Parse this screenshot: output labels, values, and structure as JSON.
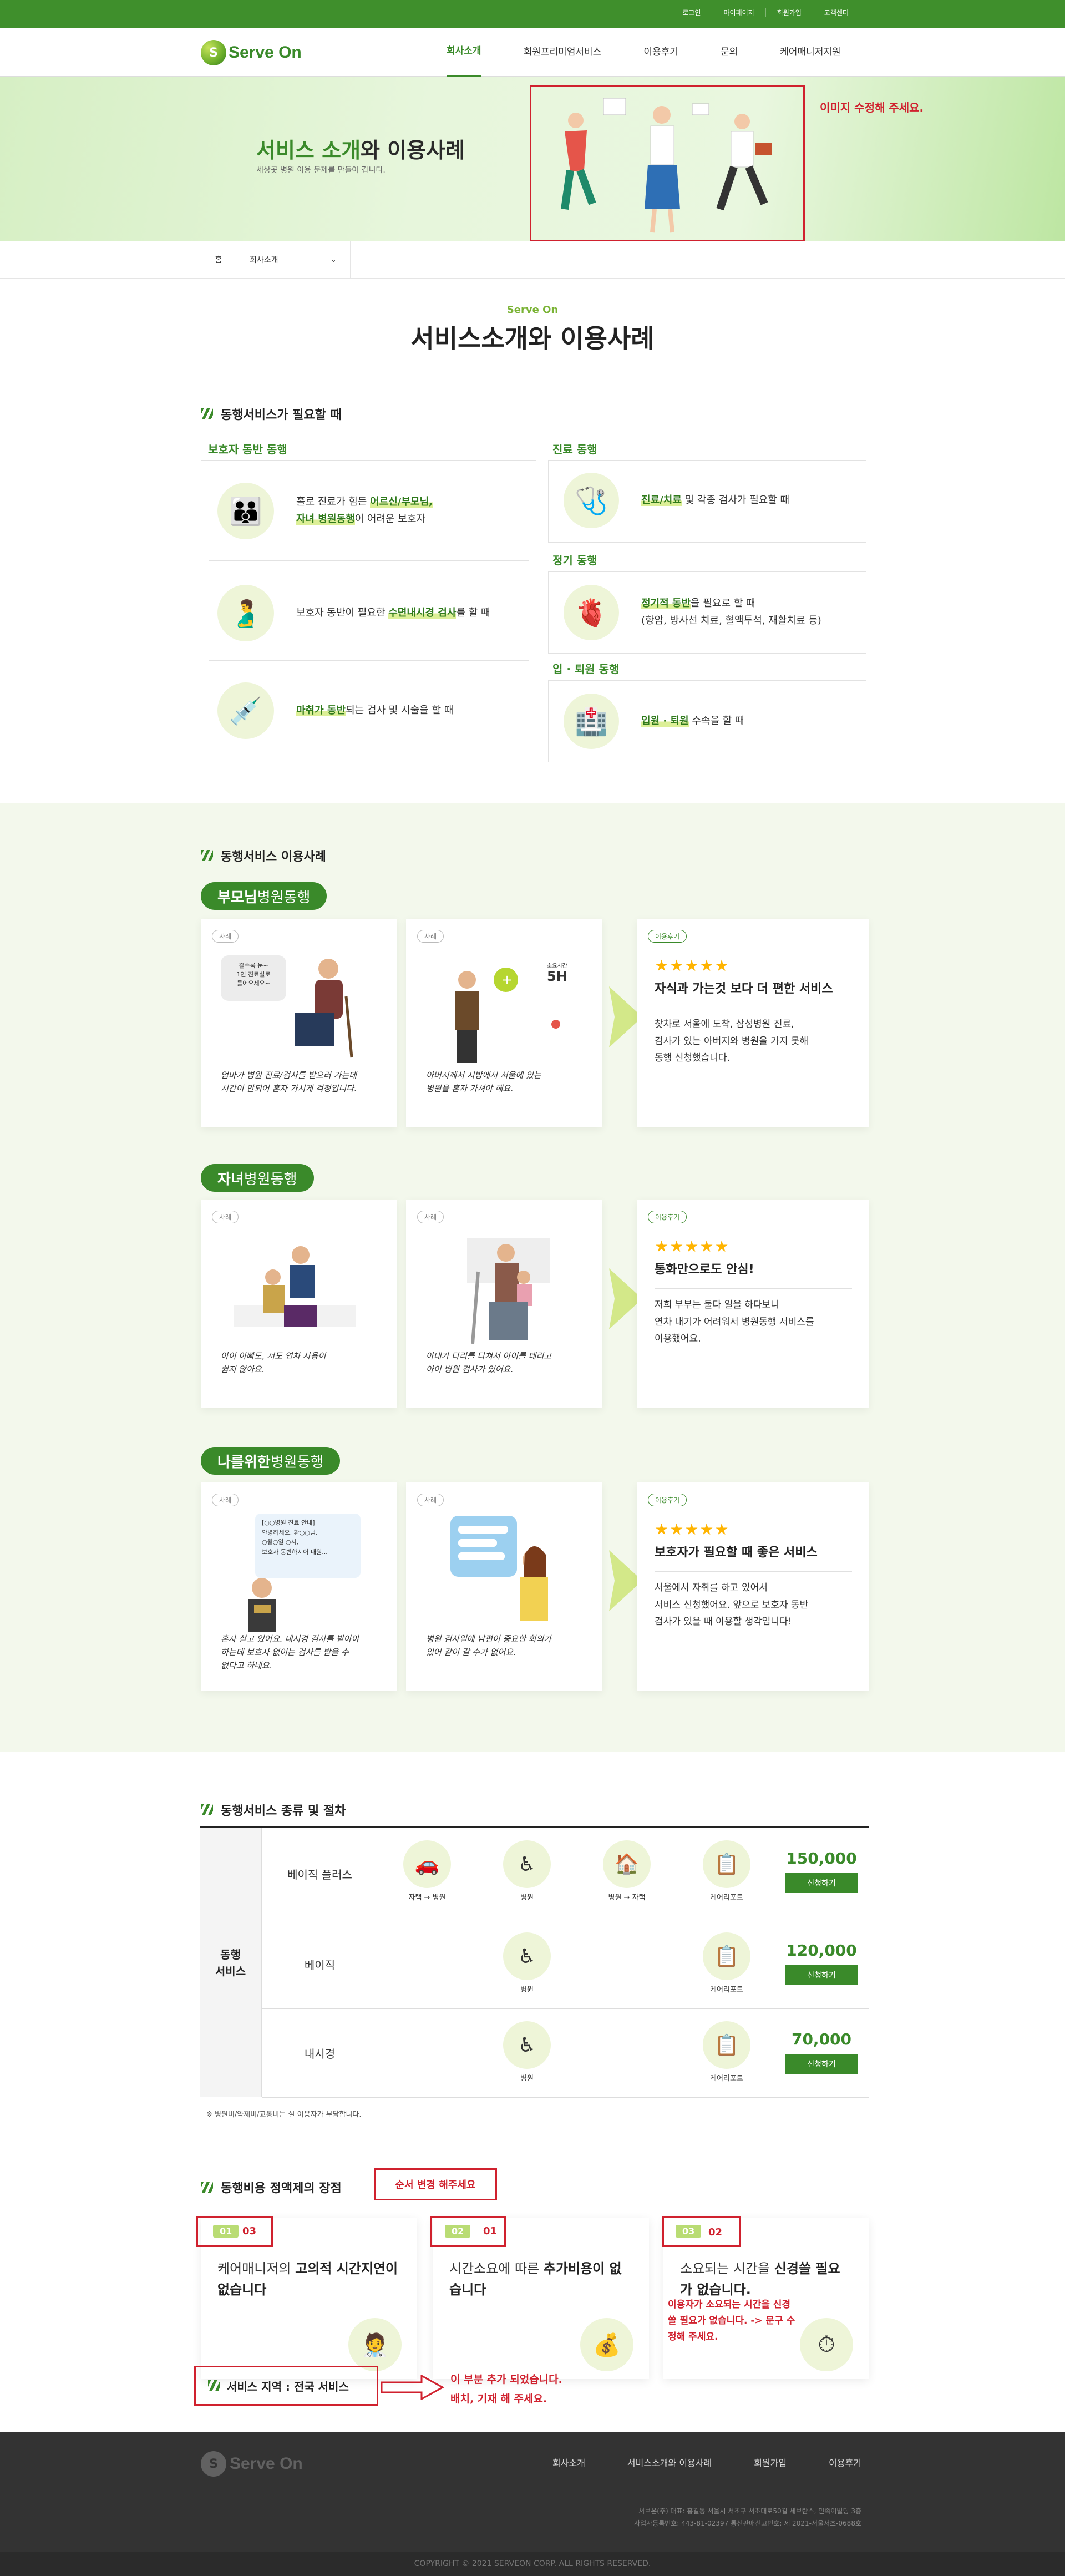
{
  "topbar": {
    "links": [
      "로그인",
      "마이페이지",
      "회원가입",
      "고객센터"
    ]
  },
  "header": {
    "logo": "Serve On",
    "logo_letter": "S",
    "nav": [
      "회사소개",
      "회원프리미엄서비스",
      "이용후기",
      "문의",
      "케어매니저지원"
    ]
  },
  "hero": {
    "title_green": "서비스 소개",
    "title_rest": "와 이용사례",
    "subtitle": "세상곳 병원 이용 문제를 만들어 갑니다.",
    "note": "이미지 수정해 주세요."
  },
  "breadcrumb": {
    "home": "홈",
    "current": "회사소개"
  },
  "intro": {
    "eyebrow": "Serve On",
    "title": "서비스소개와 이용사례"
  },
  "need": {
    "heading": "동행서비스가 필요할 때",
    "guardian": {
      "label": "보호자 동반 동행",
      "items": [
        {
          "text_a": "홀로 진료가 힘든 ",
          "hl": "어르신/부모님,",
          "text_b": "",
          "line2_hl": "자녀 병원동행",
          "line2_rest": "이 어려운 보호자"
        },
        {
          "text_a": "보호자 동반이 필요한 ",
          "hl": "수면내시경 검사",
          "text_b": "를 할 때"
        },
        {
          "text_a": "",
          "hl": "마취가 동반",
          "text_b": "되는 검사 및 시술을 할 때"
        }
      ]
    },
    "clinic": {
      "label": "진료 동행",
      "hl": "진료/치료",
      "rest": " 및 각종 검사가 필요할 때"
    },
    "regular": {
      "label": "정기 동행",
      "hl": "정기적 동반",
      "rest": "을 필요로 할 때",
      "line2": "(항암, 방사선 치료, 혈액투석, 재활치료 등)"
    },
    "admission": {
      "label": "입 · 퇴원 동행",
      "hl": "입원 · 퇴원",
      "rest": " 수속을 할 때"
    }
  },
  "cases": {
    "heading": "동행서비스 이용사례",
    "groups": [
      {
        "pill_bold": "부모님",
        "pill_rest": " 병원동행",
        "case1": {
          "tag": "사례",
          "bubble": "갈수록 눈~\n1인 진료실로\n들어오세요~",
          "hand": "엄마가 병원 진료/검사를 받으러 가는데\n시간이 안되어 혼자 가시게 걱정입니다."
        },
        "case2": {
          "tag": "사례",
          "badge": "소요시간",
          "badge_val": "5H",
          "hand": "아버지께서 지방에서 서울에 있는\n병원을 혼자 가셔야 해요."
        },
        "review": {
          "tag": "이용후기",
          "stars": "★★★★★",
          "title": "자식과 가는것 보다 더 편한 서비스",
          "body": "찾차로 서울에 도착, 삼성병원 진료,\n검사가 있는 아버지와 병원을 가지 못해\n동행 신청했습니다."
        }
      },
      {
        "pill_bold": "자녀",
        "pill_rest": " 병원동행",
        "case1": {
          "tag": "사례",
          "hand": "아이 아빠도, 저도 연차 사용이\n쉽지 않아요."
        },
        "case2": {
          "tag": "사례",
          "hand": "아내가 다리를 다쳐서 아이를 데리고\n아이 병원 검사가 있어요."
        },
        "review": {
          "tag": "이용후기",
          "stars": "★★★★★",
          "title": "통화만으로도 안심!",
          "body": "저희 부부는 둘다 일을 하다보니\n연차 내기가 어려워서 병원동행 서비스를\n이용했어요."
        }
      },
      {
        "pill_bold": "나를위한",
        "pill_rest": " 병원동행",
        "case1": {
          "tag": "사례",
          "bubble": "[○○병원 진료 안내]\n안녕하세요, 환○○님.\n○월○일 ○시,\n보호자 동반하시어 내원...",
          "hand": "혼자 살고 있어요. 내시경 검사를 받아야\n하는데 보호자 없이는 검사를 받을 수\n없다고 하네요."
        },
        "case2": {
          "tag": "사례",
          "hand": "병원 검사일에 남편이 중요한 회의가\n있어 같이 갈 수가 없어요."
        },
        "review": {
          "tag": "이용후기",
          "stars": "★★★★★",
          "title": "보호자가 필요할 때 좋은 서비스",
          "body": "서울에서 자취를 하고 있어서\n서비스 신청했어요. 앞으로 보호자 동반\n검사가 있을 때 이용할 생각입니다!"
        }
      }
    ]
  },
  "procedure": {
    "heading": "동행서비스 종류 및 절차",
    "left_label": "동행\n서비스",
    "rows": [
      {
        "name": "베이직 플러스",
        "steps": [
          "자택 → 병원",
          "병원",
          "병원 → 자택",
          "케어리포트"
        ],
        "price": "150,000",
        "button": "신청하기"
      },
      {
        "name": "베이직",
        "steps": [
          "병원",
          "케어리포트"
        ],
        "price": "120,000",
        "button": "신청하기"
      },
      {
        "name": "내시경",
        "steps": [
          "병원",
          "케어리포트"
        ],
        "price": "70,000",
        "button": "신청하기"
      }
    ],
    "note": "※ 병원비/약제비/교통비는 실 이용자가 부담합니다."
  },
  "advantages": {
    "heading": "동행비용 정액제의 장점",
    "order_note": "순서 변경 해주세요",
    "items": [
      {
        "num": "01",
        "new_num": "03",
        "title_a": "케어매니저의 ",
        "title_b": "고의적 시간지연이 없습니다",
        "title_c": ""
      },
      {
        "num": "02",
        "new_num": "01",
        "title_a": "시간소요에 따른 ",
        "title_b": "추가비용이 없습니다",
        "title_c": ""
      },
      {
        "num": "03",
        "new_num": "02",
        "title_a": "소요되는 시간을 ",
        "title_b": "신경쓸 필요가 없습니다.",
        "title_c": ""
      }
    ],
    "item3_note": "이용자가 소요되는 시간을 신경쓸 필요가 없습니다. -> 문구 수정해 주세요.",
    "region": "서비스 지역 : 전국 서비스",
    "region_note": "이 부분 추가 되었습니다.\n배치, 기재 해 주세요."
  },
  "footer": {
    "logo": "Serve On",
    "nav": [
      "회사소개",
      "서비스소개와 이용사례",
      "회원가입",
      "이용후기"
    ],
    "info1": "서브온(주) 대표: 홍길동 서울시 서초구 서초대로50길 세브란스, 민족이빌딩 3층",
    "info2": "사업자등록번호: 443-81-02397 통신판매신고번호: 제 2021-서울서초-0688호",
    "copyright": "COPYRIGHT © 2021 SERVEON CORP. ALL RIGHTS RESERVED."
  }
}
